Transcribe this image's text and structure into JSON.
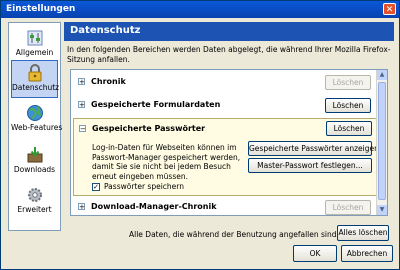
{
  "window": {
    "title": "Einstellungen"
  },
  "sidebar": {
    "items": [
      {
        "label": "Allgemein",
        "icon": "switches-icon"
      },
      {
        "label": "Datenschutz",
        "icon": "lock-icon",
        "active": true
      },
      {
        "label": "Web-Features",
        "icon": "globe-icon"
      },
      {
        "label": "Downloads",
        "icon": "download-box-icon"
      },
      {
        "label": "Erweitert",
        "icon": "gear-icon"
      }
    ]
  },
  "main": {
    "title": "Datenschutz",
    "intro": "In den folgenden Bereichen werden Daten abgelegt, die während Ihrer Mozilla Firefox-Sitzung anfallen.",
    "rows": [
      {
        "name": "Chronik",
        "button": "Löschen",
        "disabled": true,
        "expander": "+"
      },
      {
        "name": "Gespeicherte Formulardaten",
        "button": "Löschen",
        "disabled": false,
        "expander": "+"
      },
      {
        "name": "Gespeicherte Passwörter",
        "button": "Löschen",
        "disabled": false,
        "expander": "−",
        "description": "Log-in-Daten für Webseiten können im Passwort-Manager gespeichert werden, damit Sie sie nicht bei jedem Besuch erneut eingeben müssen.",
        "show_passwords": "Gespeicherte Passwörter anzeigen",
        "master_password": "Master-Passwort festlegen...",
        "checkbox_label": "Passwörter speichern",
        "checkbox_checked": true
      },
      {
        "name": "Download-Manager-Chronik",
        "button": "Löschen",
        "disabled": true,
        "expander": "+"
      }
    ]
  },
  "footer": {
    "clear_all_text": "Alle Daten, die während der Benutzung angefallen sind, löschen:",
    "clear_all_button": "Alles löschen",
    "ok": "OK",
    "cancel": "Abbrechen"
  },
  "colors": {
    "accent": "#1d54b4",
    "titlebar": "#0a58d8",
    "expanded_bg": "#fffce3"
  }
}
